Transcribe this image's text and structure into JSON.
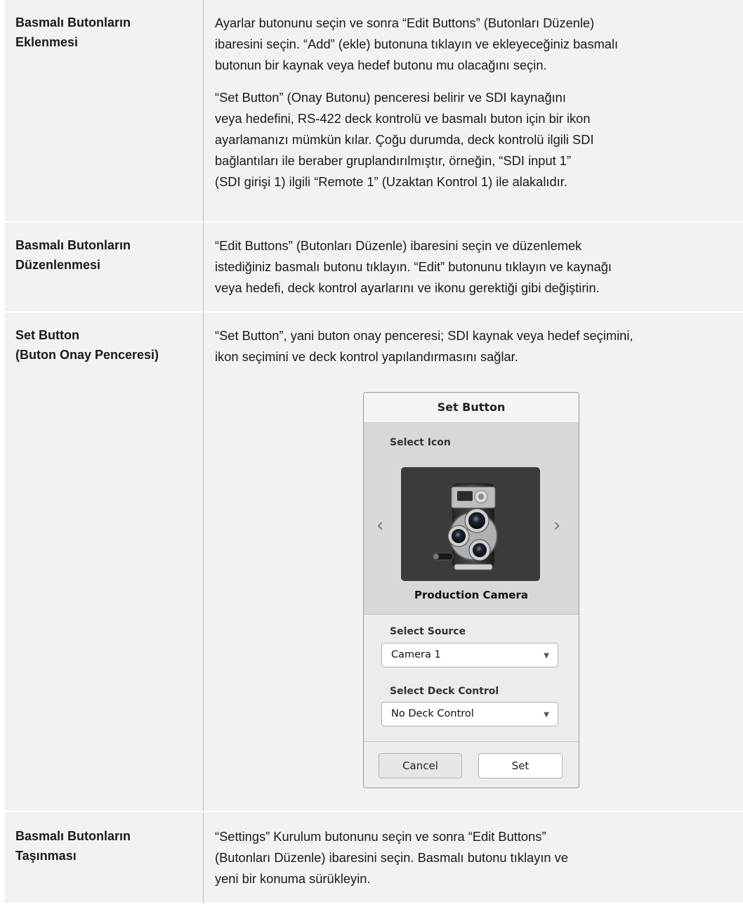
{
  "rows": [
    {
      "title_lines": [
        "Basmalı Butonların",
        "Eklenmesi"
      ],
      "paragraphs": [
        [
          "Ayarlar butonunu seçin ve sonra “Edit Buttons” (Butonları Düzenle)",
          "ibaresini seçin. “Add” (ekle) butonuna tıklayın ve ekleyeceğiniz basmalı",
          "butonun bir kaynak veya hedef butonu mu olacağını seçin."
        ],
        [
          "“Set Button” (Onay Butonu) penceresi belirir ve SDI kaynağını",
          "veya hedefini, RS-422 deck kontrolü ve basmalı buton için bir ikon",
          "ayarlamanızı mümkün kılar. Çoğu durumda, deck kontrolü ilgili SDI",
          "bağlantıları ile beraber gruplandırılmıştır, örneğin, “SDI input 1”",
          "(SDI girişi 1) ilgili “Remote 1” (Uzaktan Kontrol 1) ile alakalıdır."
        ]
      ]
    },
    {
      "title_lines": [
        "Basmalı Butonların",
        "Düzenlenmesi"
      ],
      "paragraphs": [
        [
          "“Edit Buttons” (Butonları Düzenle) ibaresini seçin ve düzenlemek",
          "istediğiniz basmalı butonu tıklayın. “Edit” butonunu tıklayın ve kaynağı",
          "veya hedefi, deck kontrol ayarlarını ve ikonu gerektiği gibi değiştirin."
        ]
      ]
    },
    {
      "title_lines": [
        "Set Button",
        "(Buton Onay Penceresi)"
      ],
      "paragraphs": [
        [
          "“Set Button”, yani buton onay penceresi; SDI kaynak veya hedef seçimini,",
          "ikon seçimini ve deck kontrol yapılandırmasını sağlar."
        ]
      ]
    },
    {
      "title_lines": [
        "Basmalı Butonların",
        "Taşınması"
      ],
      "paragraphs": [
        [
          "“Settings” Kurulum butonunu seçin ve sonra “Edit Buttons”",
          "(Butonları Düzenle) ibaresini seçin. Basmalı butonu tıklayın ve",
          "yeni bir konuma sürükleyin."
        ]
      ]
    }
  ],
  "dialog": {
    "title": "Set Button",
    "select_icon_label": "Select Icon",
    "icon_name": "Production Camera",
    "icon": "film-camera-icon",
    "prev_arrow": "‹",
    "next_arrow": "›",
    "select_source_label": "Select Source",
    "source_value": "Camera 1",
    "select_deck_label": "Select Deck Control",
    "deck_value": "No Deck Control",
    "cancel_label": "Cancel",
    "set_label": "Set"
  }
}
